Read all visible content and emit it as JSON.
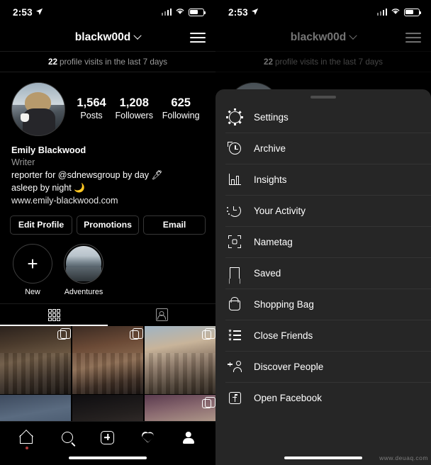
{
  "status_bar": {
    "time": "2:53",
    "location_icon": "location-arrow-icon",
    "signal_icon": "cellular-signal-icon",
    "wifi_icon": "wifi-icon",
    "battery_icon": "battery-icon"
  },
  "profile": {
    "username": "blackw00d",
    "menu_icon": "hamburger-menu-icon",
    "visits_count": "22",
    "visits_text": "profile visits in the last 7 days",
    "stats": [
      {
        "value": "1,564",
        "label": "Posts"
      },
      {
        "value": "1,208",
        "label": "Followers"
      },
      {
        "value": "625",
        "label": "Following"
      }
    ],
    "display_name": "Emily Blackwood",
    "category": "Writer",
    "bio_line1": "reporter for @sdnewsgroup by day 🖊",
    "bio_line2": "asleep by night 🌙",
    "website": "www.emily-blackwood.com",
    "actions": [
      {
        "label": "Edit Profile"
      },
      {
        "label": "Promotions"
      },
      {
        "label": "Email"
      }
    ],
    "highlights": [
      {
        "label": "New",
        "icon": "plus-icon"
      },
      {
        "label": "Adventures",
        "icon": "highlight-thumb"
      }
    ],
    "tabs": [
      {
        "name": "grid-tab",
        "icon": "grid-icon",
        "active": true
      },
      {
        "name": "tagged-tab",
        "icon": "tagged-person-icon",
        "active": false
      }
    ]
  },
  "photo_grid": [
    {
      "id": "post-1",
      "multi": true
    },
    {
      "id": "post-2",
      "multi": true
    },
    {
      "id": "post-3",
      "multi": true
    },
    {
      "id": "post-4",
      "multi": false
    },
    {
      "id": "post-5",
      "multi": false
    },
    {
      "id": "post-6",
      "multi": true
    }
  ],
  "bottom_nav": [
    {
      "name": "home",
      "icon": "home-icon",
      "badge": true
    },
    {
      "name": "search",
      "icon": "search-icon",
      "badge": false
    },
    {
      "name": "create",
      "icon": "plus-square-icon",
      "badge": false
    },
    {
      "name": "activity",
      "icon": "heart-icon",
      "badge": false
    },
    {
      "name": "profile",
      "icon": "person-icon",
      "badge": false
    }
  ],
  "menu_sheet": {
    "grabber": "drag-handle",
    "items": [
      {
        "label": "Settings",
        "icon": "gear-icon"
      },
      {
        "label": "Archive",
        "icon": "archive-clock-icon"
      },
      {
        "label": "Insights",
        "icon": "insights-bar-chart-icon"
      },
      {
        "label": "Your Activity",
        "icon": "your-activity-clock-icon"
      },
      {
        "label": "Nametag",
        "icon": "nametag-icon"
      },
      {
        "label": "Saved",
        "icon": "bookmark-icon"
      },
      {
        "label": "Shopping Bag",
        "icon": "shopping-bag-icon"
      },
      {
        "label": "Close Friends",
        "icon": "close-friends-list-icon"
      },
      {
        "label": "Discover People",
        "icon": "discover-people-icon"
      },
      {
        "label": "Open Facebook",
        "icon": "facebook-icon"
      }
    ]
  },
  "watermark": "www.deuaq.com",
  "colors": {
    "background": "#000000",
    "sheet_background": "#262626",
    "divider": "#343434",
    "muted_text": "#9a9a9a",
    "badge_red": "#b03a3a"
  }
}
